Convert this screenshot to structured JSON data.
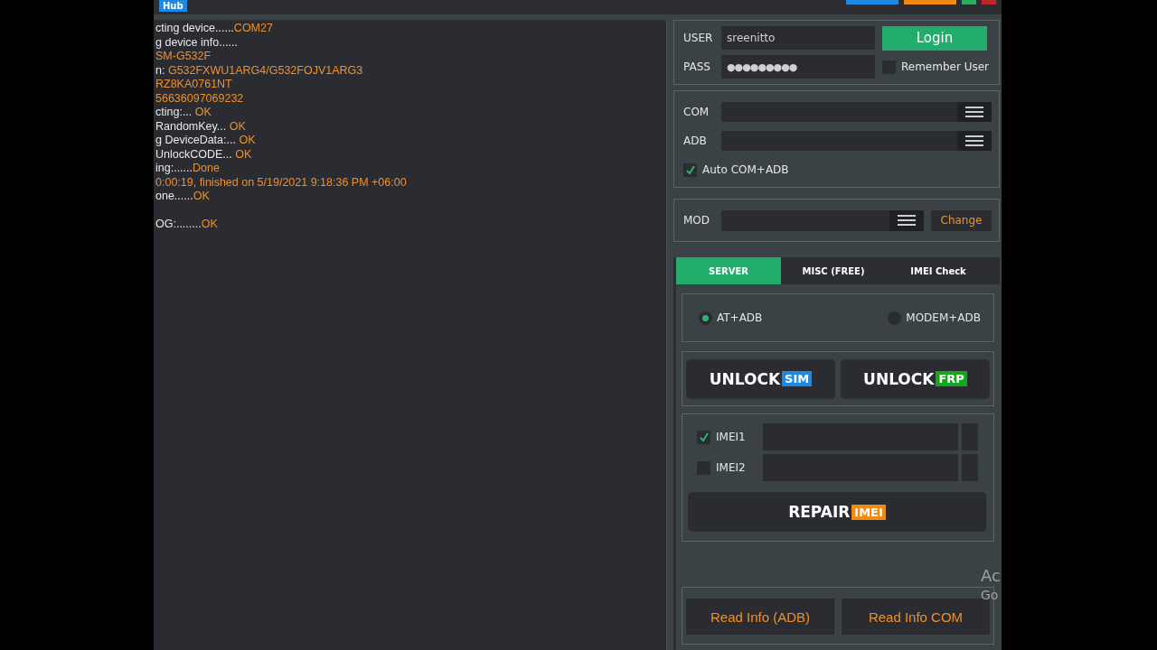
{
  "title_bar": {
    "badge": "Hub"
  },
  "log": [
    {
      "kind": "line",
      "text": "cting device......",
      "value": "COM27"
    },
    {
      "kind": "line",
      "text": "g device info......"
    },
    {
      "kind": "line",
      "value": "SM-G532F"
    },
    {
      "kind": "line",
      "text": "n: ",
      "value": "G532FXWU1ARG4/G532FOJV1ARG3"
    },
    {
      "kind": "line",
      "value": "RZ8KA0761NT"
    },
    {
      "kind": "line",
      "value": "56636097069232"
    },
    {
      "kind": "line",
      "text": "cting:... ",
      "value": "OK"
    },
    {
      "kind": "line",
      "text": "RandomKey... ",
      "value": "OK"
    },
    {
      "kind": "line",
      "text": "g DeviceData:... ",
      "value": "OK"
    },
    {
      "kind": "line",
      "text": "UnlockCODE... ",
      "value": "OK"
    },
    {
      "kind": "line",
      "text": "ing:......",
      "value": "Done"
    },
    {
      "kind": "line",
      "value": "0:00:19, finished on 5/19/2021 9:18:36 PM +06:00"
    },
    {
      "kind": "line",
      "text": "one......",
      "value": "OK"
    },
    {
      "kind": "blank"
    },
    {
      "kind": "line",
      "text": "OG:........",
      "value": "OK"
    }
  ],
  "login": {
    "user_label": "USER",
    "user": "sreenitto",
    "pass_label": "PASS",
    "password": "●●●●●●●●●",
    "login_button": "Login",
    "remember": {
      "label": "Remember User",
      "checked": false
    }
  },
  "ports": {
    "com_label": "COM",
    "adb_label": "ADB",
    "auto": {
      "label": "Auto COM+ADB",
      "checked": true
    }
  },
  "mod": {
    "label": "MOD",
    "button": "Change"
  },
  "tabs": [
    {
      "label": "SERVER",
      "selected": true
    },
    {
      "label": "MISC (FREE)",
      "selected": false
    },
    {
      "label": "IMEI Check",
      "selected": false
    }
  ],
  "modes": [
    {
      "label": "AT+ADB",
      "selected": true
    },
    {
      "label": "MODEM+ADB",
      "selected": false
    }
  ],
  "unlock_buttons": [
    {
      "label": "UNLOCK",
      "badge": "SIM",
      "color": "#1e88e5"
    },
    {
      "label": "UNLOCK",
      "badge": "FRP",
      "color": "#13a81b"
    }
  ],
  "imei": [
    {
      "label": "IMEI1",
      "checked": true
    },
    {
      "label": "IMEI2",
      "checked": false
    }
  ],
  "repair_button": {
    "label": "REPAIR",
    "badge": "IMEI",
    "color": "#f28a12"
  },
  "read_buttons": [
    "Read Info (ADB)",
    "Read Info COM"
  ],
  "activation_notice": [
    "Ac",
    "Go"
  ]
}
